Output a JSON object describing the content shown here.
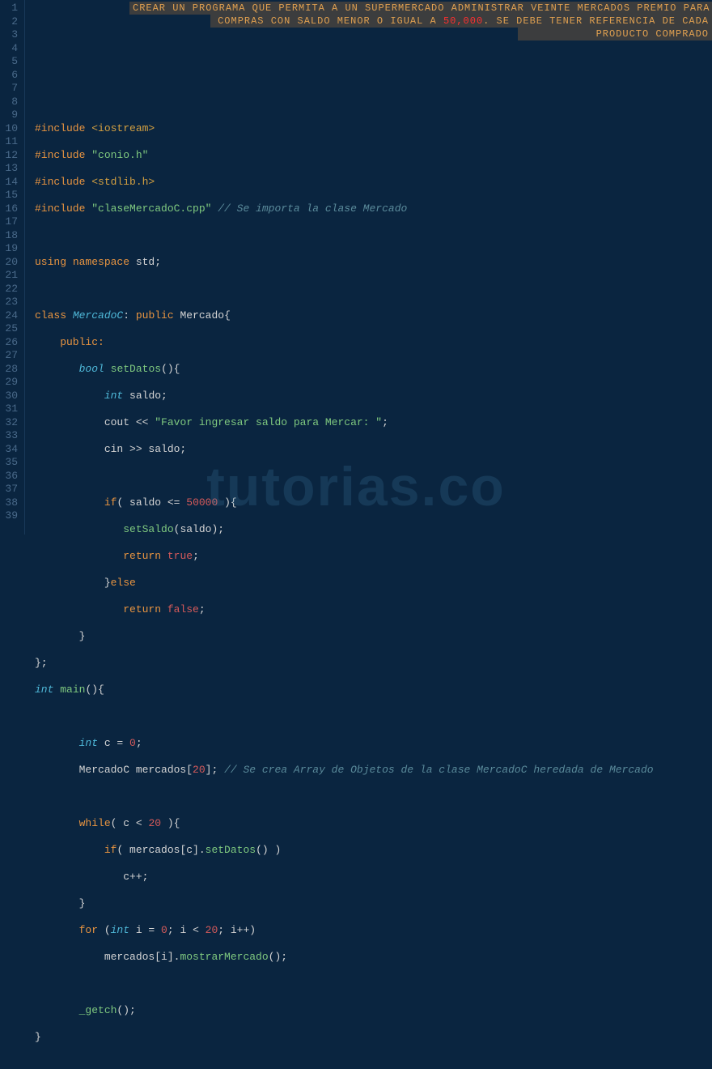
{
  "banner": {
    "line1": "CREAR UN PROGRAMA QUE PERMITA A UN SUPERMERCADO ADMINISTRAR VEINTE MERCADOS PREMIO PARA",
    "line2_a": "COMPRAS CON SALDO MENOR O IGUAL A ",
    "line2_num": "50,000",
    "line2_b": ". SE DEBE TENER REFERENCIA DE CADA",
    "line3": "PRODUCTO COMPRADO"
  },
  "watermark": "tutorias.co",
  "gutter": [
    "1",
    "2",
    "3",
    "4",
    "5",
    "6",
    "7",
    "8",
    "9",
    "10",
    "11",
    "12",
    "13",
    "14",
    "15",
    "16",
    "17",
    "18",
    "19",
    "20",
    "21",
    "22",
    "23",
    "24",
    "25",
    "26",
    "27",
    "28",
    "29",
    "30",
    "31",
    "32",
    "33",
    "34",
    "35",
    "36",
    "37",
    "38",
    "39"
  ],
  "code": {
    "l5_inc": "#include ",
    "l5_hdr": "<iostream>",
    "l6_inc": "#include ",
    "l6_hdr": "\"conio.h\"",
    "l7_inc": "#include ",
    "l7_hdr": "<stdlib.h>",
    "l8_inc": "#include ",
    "l8_hdr": "\"claseMercadoC.cpp\"",
    "l8_cmt": " // Se importa la clase Mercado",
    "l10_a": "using",
    "l10_b": " namespace",
    "l10_c": " std;",
    "l12_a": "class ",
    "l12_b": "MercadoC",
    "l12_c": ": ",
    "l12_d": "public",
    "l12_e": " Mercado{",
    "l13": "    public:",
    "l14_a": "       ",
    "l14_b": "bool",
    "l14_c": " ",
    "l14_d": "setDatos",
    "l14_e": "(){",
    "l15_a": "           ",
    "l15_b": "int",
    "l15_c": " saldo;",
    "l16_a": "           cout << ",
    "l16_b": "\"Favor ingresar saldo para Mercar: \"",
    "l16_c": ";",
    "l17": "           cin >> saldo;",
    "l19_a": "           ",
    "l19_b": "if",
    "l19_c": "( saldo <= ",
    "l19_d": "50000",
    "l19_e": " ){",
    "l20_a": "              ",
    "l20_b": "setSaldo",
    "l20_c": "(saldo);",
    "l21_a": "              ",
    "l21_b": "return",
    "l21_c": " ",
    "l21_d": "true",
    "l21_e": ";",
    "l22_a": "           }",
    "l22_b": "else",
    "l23_a": "              ",
    "l23_b": "return",
    "l23_c": " ",
    "l23_d": "false",
    "l23_e": ";",
    "l24": "       }",
    "l25": "};",
    "l26_a": "int",
    "l26_b": " ",
    "l26_c": "main",
    "l26_d": "(){",
    "l28_a": "       ",
    "l28_b": "int",
    "l28_c": " c = ",
    "l28_d": "0",
    "l28_e": ";",
    "l29_a": "       MercadoC mercados[",
    "l29_b": "20",
    "l29_c": "]; ",
    "l29_d": "// Se crea Array de Objetos de la clase MercadoC heredada de Mercado",
    "l31_a": "       ",
    "l31_b": "while",
    "l31_c": "( c < ",
    "l31_d": "20",
    "l31_e": " ){",
    "l32_a": "           ",
    "l32_b": "if",
    "l32_c": "( mercados[c].",
    "l32_d": "setDatos",
    "l32_e": "() )",
    "l33": "              c++;",
    "l34": "       }",
    "l35_a": "       ",
    "l35_b": "for",
    "l35_c": " (",
    "l35_d": "int",
    "l35_e": " i = ",
    "l35_f": "0",
    "l35_g": "; i < ",
    "l35_h": "20",
    "l35_i": "; i++)",
    "l36_a": "           mercados[i].",
    "l36_b": "mostrarMercado",
    "l36_c": "();",
    "l38_a": "       ",
    "l38_b": "_getch",
    "l38_c": "();",
    "l39": "}"
  }
}
